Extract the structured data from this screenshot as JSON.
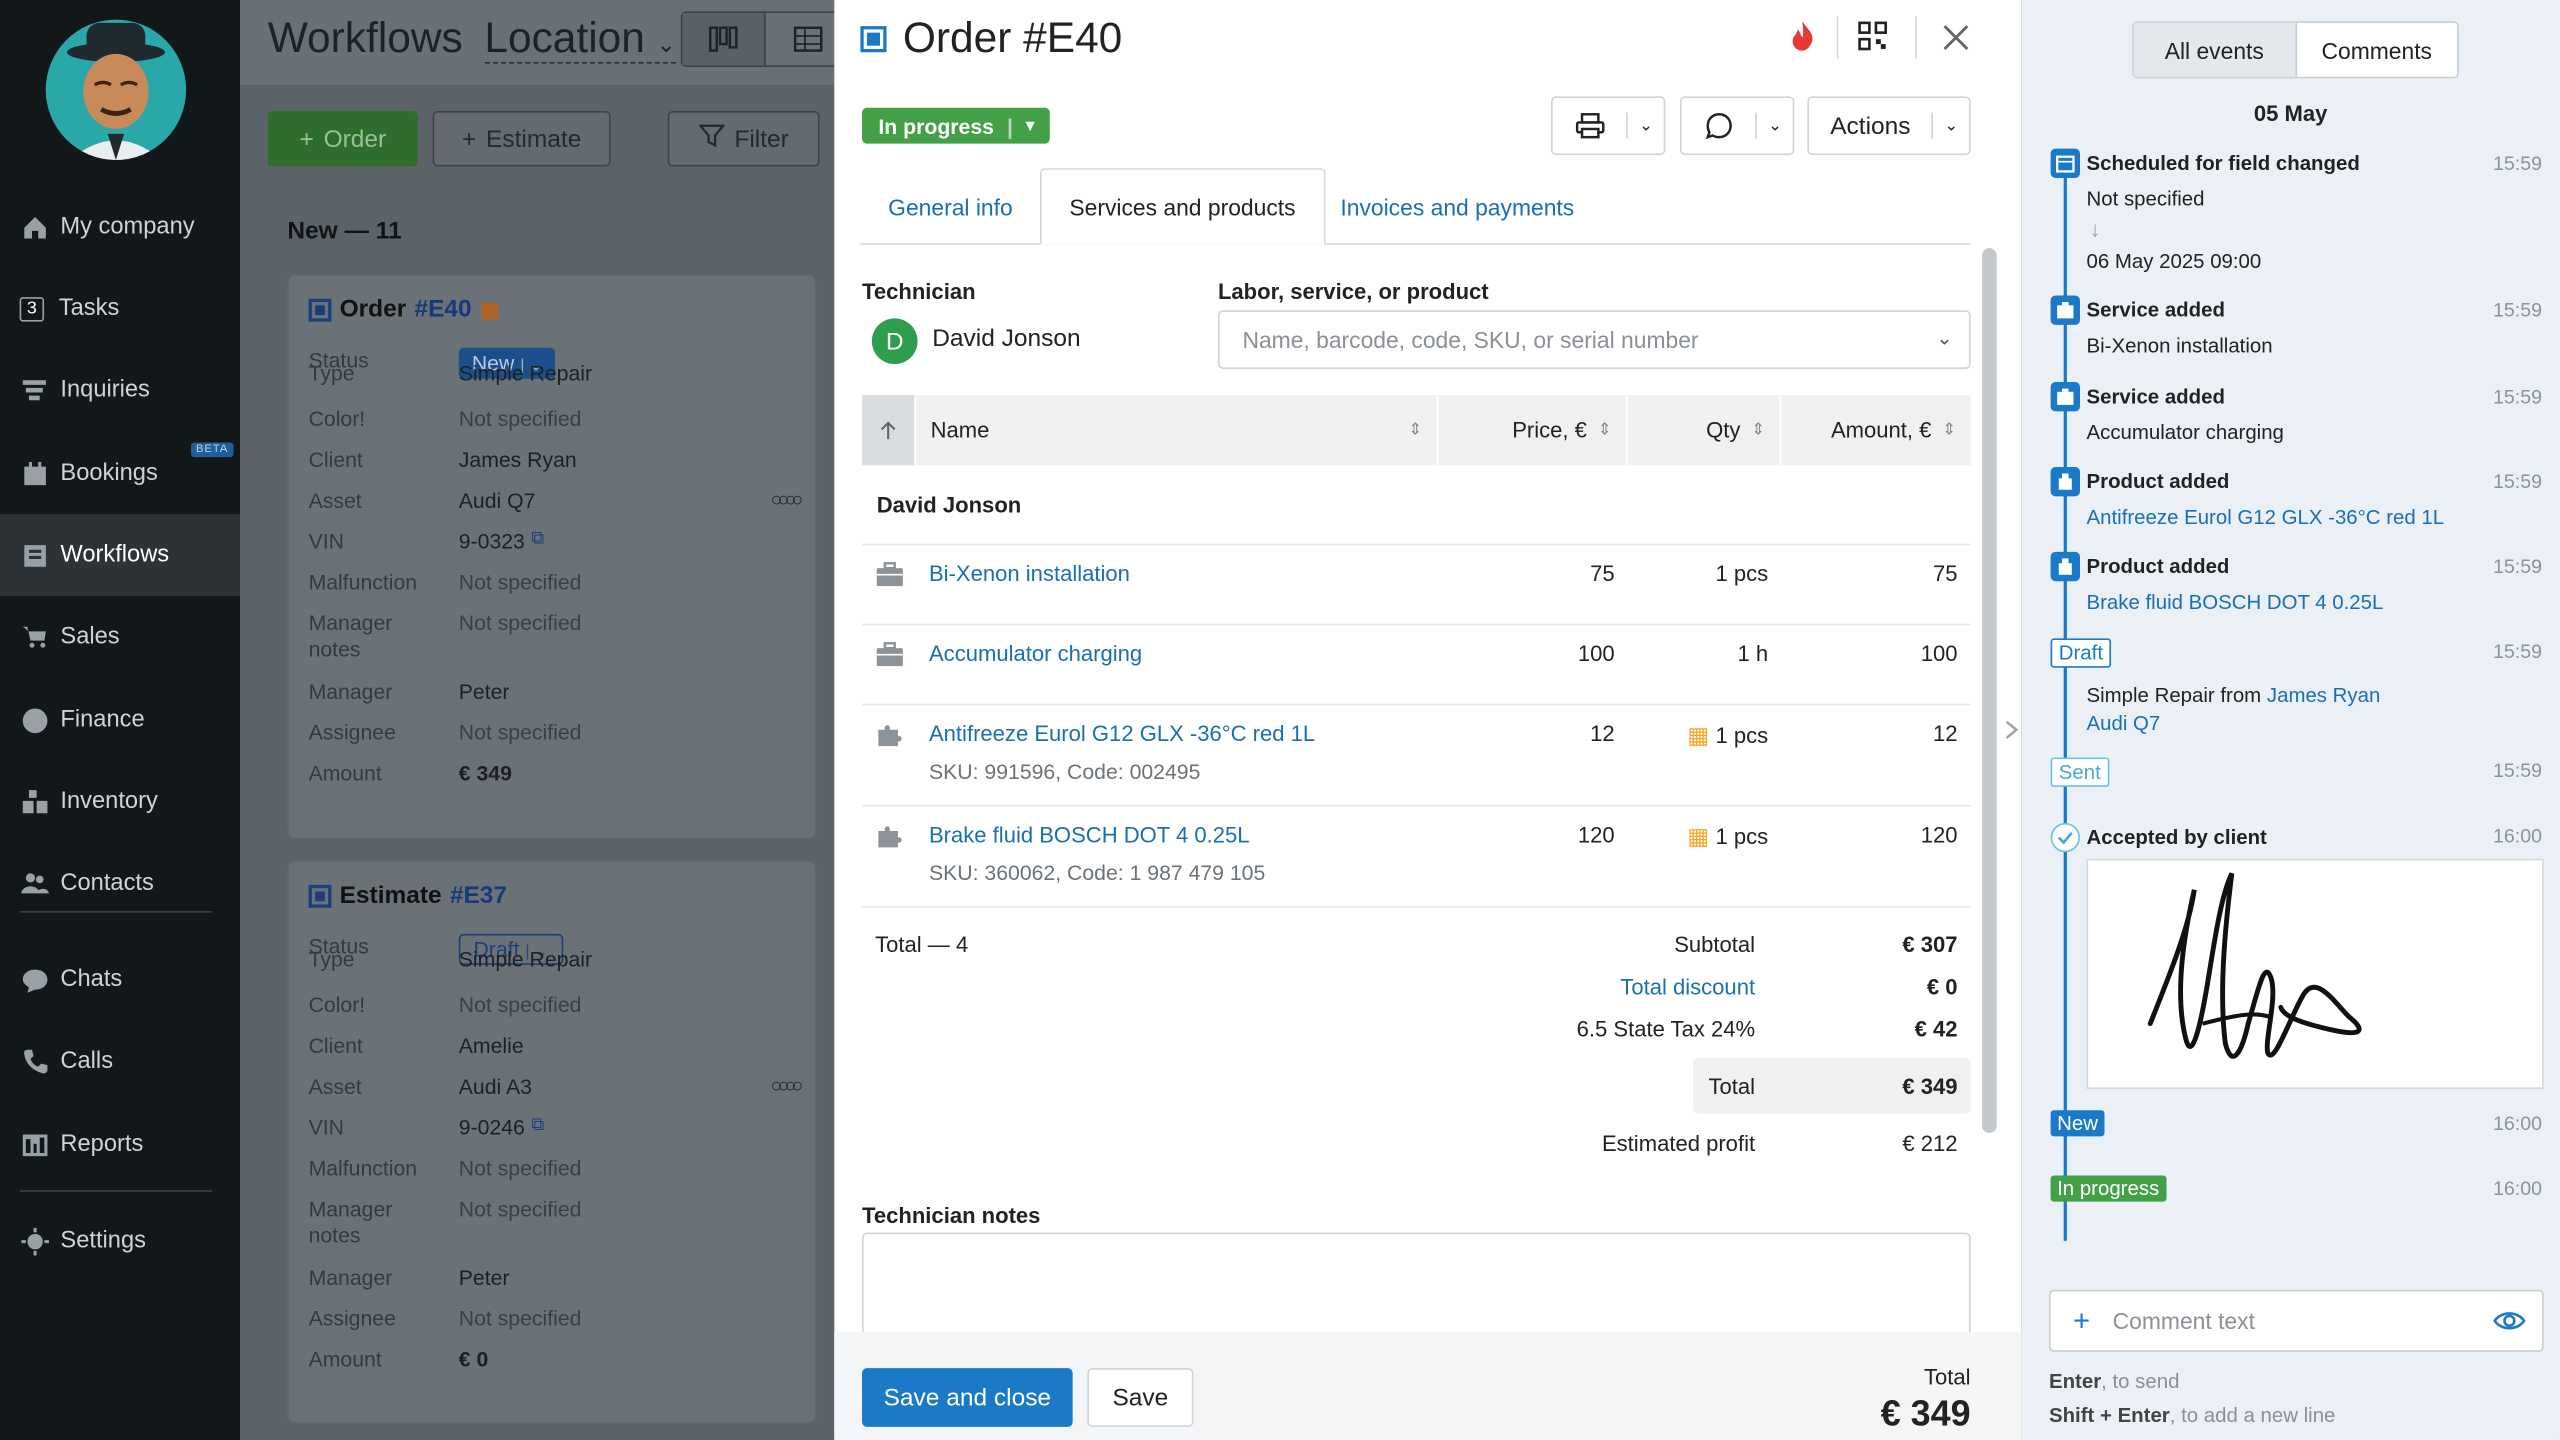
{
  "sidebar": {
    "items": [
      {
        "label": "My company",
        "icon": "home-icon"
      },
      {
        "label": "Tasks",
        "icon": "tasks-icon",
        "badge": "3"
      },
      {
        "label": "Inquiries",
        "icon": "funnel-icon"
      },
      {
        "label": "Bookings",
        "icon": "calendar-icon",
        "tag": "BETA"
      },
      {
        "label": "Workflows",
        "icon": "workflows-icon",
        "active": true
      },
      {
        "label": "Sales",
        "icon": "cart-icon"
      },
      {
        "label": "Finance",
        "icon": "dollar-icon"
      },
      {
        "label": "Inventory",
        "icon": "boxes-icon"
      },
      {
        "label": "Contacts",
        "icon": "people-icon"
      },
      {
        "label": "Chats",
        "icon": "chat-icon"
      },
      {
        "label": "Calls",
        "icon": "phone-icon"
      },
      {
        "label": "Reports",
        "icon": "reports-icon"
      },
      {
        "label": "Settings",
        "icon": "gear-icon"
      }
    ]
  },
  "board": {
    "title": "Workflows",
    "location": "Location",
    "order_btn": "Order",
    "estimate_btn": "Estimate",
    "filter_btn": "Filter",
    "column_title": "New — 11",
    "cards": [
      {
        "kind": "Order",
        "num": "#E40",
        "status": "New",
        "rows": [
          {
            "k": "Type",
            "v": "Simple Repair"
          },
          {
            "k": "Color!",
            "v": "Not specified"
          },
          {
            "k": "Client",
            "v": "James Ryan"
          },
          {
            "k": "Asset",
            "v": "Audi Q7"
          },
          {
            "k": "VIN",
            "v": "9-0323"
          },
          {
            "k": "Malfunction",
            "v": "Not specified"
          },
          {
            "k": "Manager",
            "v": "Not specified",
            "k2": "notes"
          },
          {
            "k": "Manager",
            "v": "Peter"
          },
          {
            "k": "Assignee",
            "v": "Not specified"
          },
          {
            "k": "Amount",
            "v": "€ 349"
          }
        ]
      },
      {
        "kind": "Estimate",
        "num": "#E37",
        "status": "Draft",
        "rows": [
          {
            "k": "Type",
            "v": "Simple Repair"
          },
          {
            "k": "Color!",
            "v": "Not specified"
          },
          {
            "k": "Client",
            "v": "Amelie"
          },
          {
            "k": "Asset",
            "v": "Audi A3"
          },
          {
            "k": "VIN",
            "v": "9-0246"
          },
          {
            "k": "Malfunction",
            "v": "Not specified"
          },
          {
            "k": "Manager",
            "v": "Not specified",
            "k2": "notes"
          },
          {
            "k": "Manager",
            "v": "Peter"
          },
          {
            "k": "Assignee",
            "v": "Not specified"
          },
          {
            "k": "Amount",
            "v": "€ 0"
          }
        ]
      }
    ]
  },
  "modal": {
    "title": "Order #E40",
    "status": "In progress",
    "actions": "Actions",
    "tabs": [
      "General info",
      "Services and products",
      "Invoices and payments"
    ],
    "technician_label": "Technician",
    "technician_initial": "D",
    "technician_name": "David Jonson",
    "labor_label": "Labor, service, or product",
    "search_placeholder": "Name, barcode, code, SKU, or serial number",
    "columns": {
      "name": "Name",
      "price": "Price, €",
      "qty": "Qty",
      "amount": "Amount, €"
    },
    "group": "David Jonson",
    "rows": [
      {
        "name": "Bi-Xenon installation",
        "price": "75",
        "qty": "1 pcs",
        "amount": "75",
        "kind": "service"
      },
      {
        "name": "Accumulator charging",
        "price": "100",
        "qty": "1 h",
        "amount": "100",
        "kind": "service"
      },
      {
        "name": "Antifreeze Eurol G12 GLX -36°C red 1L",
        "sub": "SKU: 991596, Code: 002495",
        "price": "12",
        "qty": "1 pcs",
        "amount": "12",
        "kind": "product"
      },
      {
        "name": "Brake fluid BOSCH DOT 4 0.25L",
        "sub": "SKU: 360062, Code: 1 987 479 105",
        "price": "120",
        "qty": "1 pcs",
        "amount": "120",
        "kind": "product"
      }
    ],
    "total_count": "Total — 4",
    "subtotal_label": "Subtotal",
    "subtotal": "€ 307",
    "discount_label": "Total discount",
    "discount": "€ 0",
    "tax_label": "6.5 State Tax 24%",
    "tax": "€ 42",
    "total_label": "Total",
    "total": "€ 349",
    "profit_label": "Estimated profit",
    "profit": "€ 212",
    "notes_label": "Technician notes",
    "save_close": "Save and close",
    "save": "Save",
    "footer_total_label": "Total",
    "footer_total": "€ 349"
  },
  "events": {
    "tabs": [
      "All events",
      "Comments"
    ],
    "date": "05 May",
    "items": [
      {
        "title": "Scheduled for field changed",
        "time": "15:59",
        "from": "Not specified",
        "to": "06 May 2025 09:00"
      },
      {
        "title": "Service added",
        "time": "15:59",
        "text": "Bi-Xenon installation"
      },
      {
        "title": "Service added",
        "time": "15:59",
        "text": "Accumulator charging"
      },
      {
        "title": "Product added",
        "time": "15:59",
        "link": "Antifreeze Eurol G12 GLX -36°C red 1L"
      },
      {
        "title": "Product added",
        "time": "15:59",
        "link": "Brake fluid BOSCH DOT 4 0.25L"
      },
      {
        "chip": "Draft",
        "time": "15:59",
        "text": "Simple Repair from",
        "client": "James Ryan",
        "asset": "Audi Q7"
      },
      {
        "chip": "Sent",
        "time": "15:59"
      },
      {
        "title": "Accepted by client",
        "time": "16:00"
      },
      {
        "chip": "New",
        "time": "16:00"
      },
      {
        "chip": "In progress",
        "time": "16:00"
      }
    ],
    "comment_placeholder": "Comment text",
    "hint1_key": "Enter",
    "hint1": ", to send",
    "hint2_key": "Shift + Enter",
    "hint2": ", to add a new line"
  },
  "colors": {
    "accent": "#1a7ac8",
    "green": "#43a047",
    "sidebar": "#121719"
  }
}
